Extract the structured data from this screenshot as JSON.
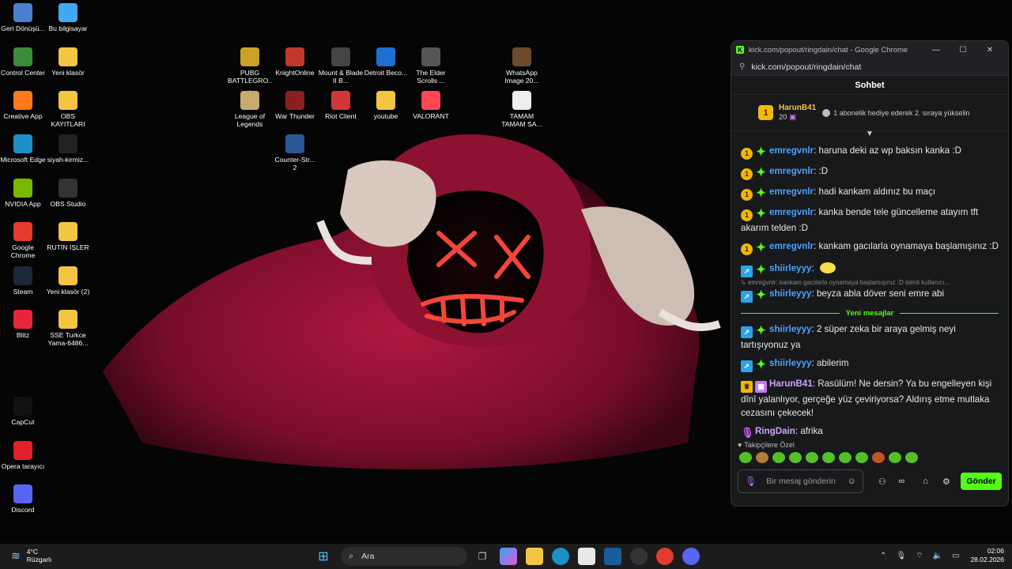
{
  "desktop": {
    "icons": [
      {
        "label": "Geri Dönüşü...",
        "icon": "recycle-bin-icon",
        "color": "#4a7fd0"
      },
      {
        "label": "Bu bilgisayar",
        "icon": "computer-icon",
        "color": "#3fa9f5"
      },
      {
        "label": "Control Center",
        "icon": "control-center-icon",
        "color": "#3a8b3a"
      },
      {
        "label": "Yeni klasör",
        "icon": "folder-icon",
        "color": "#f4c542"
      },
      {
        "label": "Creative App",
        "icon": "creative-app-icon",
        "color": "#ff7a1a"
      },
      {
        "label": "OBS KAYITLARI",
        "icon": "folder-icon",
        "color": "#f4c542"
      },
      {
        "label": "Microsoft Edge",
        "icon": "edge-icon",
        "color": "#1e90c8"
      },
      {
        "label": "siyah-kirmiz...",
        "icon": "image-file-icon",
        "color": "#222222"
      },
      {
        "label": "NVIDIA App",
        "icon": "nvidia-icon",
        "color": "#76b900"
      },
      {
        "label": "OBS Studio",
        "icon": "obs-icon",
        "color": "#333333"
      },
      {
        "label": "Google Chrome",
        "icon": "chrome-icon",
        "color": "#e33b2e"
      },
      {
        "label": "RUTİN İŞLER",
        "icon": "folder-icon",
        "color": "#f4c542"
      },
      {
        "label": "Steam",
        "icon": "steam-icon",
        "color": "#1b2838"
      },
      {
        "label": "Yeni klasör (2)",
        "icon": "folder-icon",
        "color": "#f4c542"
      },
      {
        "label": "Blitz",
        "icon": "blitz-icon",
        "color": "#e8243a"
      },
      {
        "label": "SSE Turkce Yama-6486...",
        "icon": "folder-icon",
        "color": "#f4c542"
      },
      {
        "label": "CapCut",
        "icon": "capcut-icon",
        "color": "#111111"
      },
      {
        "label": "Opera tarayıcı",
        "icon": "opera-icon",
        "color": "#e0202a"
      },
      {
        "label": "Discord",
        "icon": "discord-icon",
        "color": "#5865f2"
      },
      {
        "label": "PUBG BATTLEGRO...",
        "icon": "pubg-icon",
        "color": "#c9a227"
      },
      {
        "label": "KnightOnline",
        "icon": "knightonline-icon",
        "color": "#c0392b"
      },
      {
        "label": "Mount & Blade II B...",
        "icon": "bannerlord-icon",
        "color": "#444444"
      },
      {
        "label": "Detroit Beco...",
        "icon": "detroit-icon",
        "color": "#1f6fd1"
      },
      {
        "label": "The Elder Scrolls ...",
        "icon": "elder-scrolls-icon",
        "color": "#555555"
      },
      {
        "label": "WhatsApp Image 20...",
        "icon": "image-file-icon",
        "color": "#6b4b2a"
      },
      {
        "label": "League of Legends",
        "icon": "lol-icon",
        "color": "#c8aa6e"
      },
      {
        "label": "War Thunder",
        "icon": "war-thunder-icon",
        "color": "#8a1f1f"
      },
      {
        "label": "Riot Client",
        "icon": "riot-icon",
        "color": "#d13639"
      },
      {
        "label": "youtube",
        "icon": "folder-icon",
        "color": "#f4c542"
      },
      {
        "label": "VALORANT",
        "icon": "valorant-icon",
        "color": "#ff4655"
      },
      {
        "label": "TAMAM TAMAM SA...",
        "icon": "video-file-icon",
        "color": "#eeeeee"
      },
      {
        "label": "Counter-Str... 2",
        "icon": "cs2-icon",
        "color": "#2b5797"
      }
    ]
  },
  "chat_window": {
    "window_title": "kick.com/popout/ringdain/chat - Google Chrome",
    "logo_letter": "K",
    "url": "kick.com/popout/ringdain/chat",
    "header": "Sohbet",
    "pinned": {
      "username": "HarunB41",
      "count": "20",
      "badge_text": "1",
      "message": "1 abonelik hediye ederek 2. sıraya yükselin"
    },
    "messages": [
      {
        "badge1": "1",
        "user": "emregvnlr",
        "text": "haruna deki az wp baksın kanka :D"
      },
      {
        "badge1": "1",
        "user": "emregvnlr",
        "text": ":D"
      },
      {
        "badge1": "1",
        "user": "emregvnlr",
        "text": "hadi kankam aldınız bu maçı"
      },
      {
        "badge1": "1",
        "user": "emregvnlr",
        "text": "kanka bende tele güncelleme atayım tft akarım telden :D"
      },
      {
        "badge1": "1",
        "user": "emregvnlr",
        "text": "kankam gacılarla oynamaya başlamışınız :D"
      },
      {
        "user": "shiirleyyy",
        "text": ""
      },
      {
        "reply": "emregvnlr: kankam gacılarla oynamaya başlamışınız :D isimli kullanıcı..."
      },
      {
        "user": "shiirleyyy",
        "text": "beyza abla döver seni emre abi"
      },
      {
        "divider": "Yeni mesajlar"
      },
      {
        "user": "shiirleyyy",
        "text": "2 süper zeka bir araya gelmiş neyi tartışıyonuz ya"
      },
      {
        "user": "shiirleyyy",
        "text": "abilerim"
      },
      {
        "user": "HarunB41",
        "text": "Rasûlüm! Ne dersin? Ya bu engelleyen kişi dînî yalanlıyor, gerçeğe yüz çeviriyorsa? Aldırış etme mutlaka cezasını çekecek!"
      },
      {
        "user": "RingDain",
        "text": "afrika"
      }
    ],
    "emote_section": "Takipçilere Özel",
    "input_placeholder": "Bir mesaj gönderin",
    "send_label": "Gönder"
  },
  "taskbar": {
    "weather_temp": "4°C",
    "weather_desc": "Rüzgarlı",
    "search_label": "Ara",
    "time": "02:06",
    "date": "28.02.2026"
  },
  "colors": {
    "kick_green": "#53fc18",
    "hoodie_red": "#a8163a",
    "mask_glow": "#ff3b30"
  }
}
